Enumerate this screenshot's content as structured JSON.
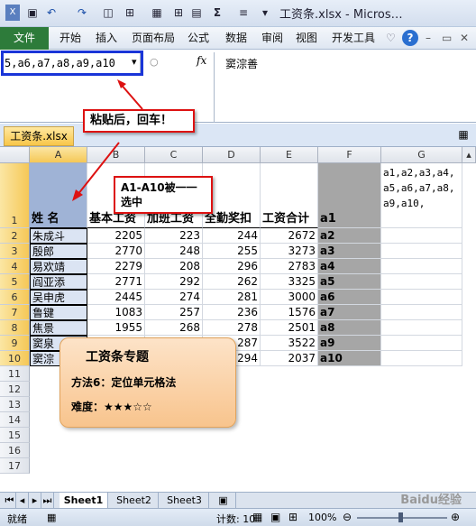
{
  "titlebar": {
    "title": "工资条.xlsx - Micros…",
    "undo": "↶",
    "redo": "↷",
    "sigma": "Σ"
  },
  "ribbon": {
    "file": "文件",
    "tabs": [
      "开始",
      "插入",
      "页面布局",
      "公式",
      "数据",
      "审阅",
      "视图",
      "开发工具"
    ]
  },
  "formula": {
    "namebox": "5,a6,a7,a8,a9,a10",
    "fx": "fx",
    "value": "窦淙善"
  },
  "workbook": {
    "name": "工资条.xlsx"
  },
  "columns": [
    "A",
    "B",
    "C",
    "D",
    "E",
    "F",
    "G"
  ],
  "rows": [
    "1",
    "2",
    "3",
    "4",
    "5",
    "6",
    "7",
    "8",
    "9",
    "10",
    "11",
    "12",
    "13",
    "14",
    "15",
    "16",
    "17"
  ],
  "headers": [
    "姓 名",
    "基本工资",
    "加班工资",
    "全勤奖扣",
    "工资合计",
    "a1"
  ],
  "data": [
    {
      "name": "朱成斗",
      "b": "2205",
      "c": "223",
      "d": "244",
      "e": "2672",
      "f": "a2"
    },
    {
      "name": "殷郎",
      "b": "2770",
      "c": "248",
      "d": "255",
      "e": "3273",
      "f": "a3"
    },
    {
      "name": "易欢靖",
      "b": "2279",
      "c": "208",
      "d": "296",
      "e": "2783",
      "f": "a4"
    },
    {
      "name": "阎亚添",
      "b": "2771",
      "c": "292",
      "d": "262",
      "e": "3325",
      "f": "a5"
    },
    {
      "name": "吴申虎",
      "b": "2445",
      "c": "274",
      "d": "281",
      "e": "3000",
      "f": "a6"
    },
    {
      "name": "鲁键",
      "b": "1083",
      "c": "257",
      "d": "236",
      "e": "1576",
      "f": "a7"
    },
    {
      "name": "焦景",
      "b": "1955",
      "c": "268",
      "d": "278",
      "e": "2501",
      "f": "a8"
    },
    {
      "name": "窦泉",
      "b": "",
      "c": "",
      "d": "287",
      "e": "3522",
      "f": "a9"
    },
    {
      "name": "窦淙",
      "b": "",
      "c": "",
      "d": "294",
      "e": "2037",
      "f": "a10"
    }
  ],
  "g_text": "a1,a2,a3,a4,a5,a6,a7,a8,a9,a10,",
  "callouts": {
    "paste": "粘贴后，回车！",
    "select": "A1-A10被一一选中"
  },
  "note": {
    "title": "工资条专题",
    "method": "方法6：定位单元格法",
    "difficulty": "难度：★★★☆☆"
  },
  "sheets": [
    "Sheet1",
    "Sheet2",
    "Sheet3"
  ],
  "status": {
    "ready": "就绪",
    "count": "计数: 10",
    "zoom": "100%"
  },
  "watermark": "Baidu经验"
}
